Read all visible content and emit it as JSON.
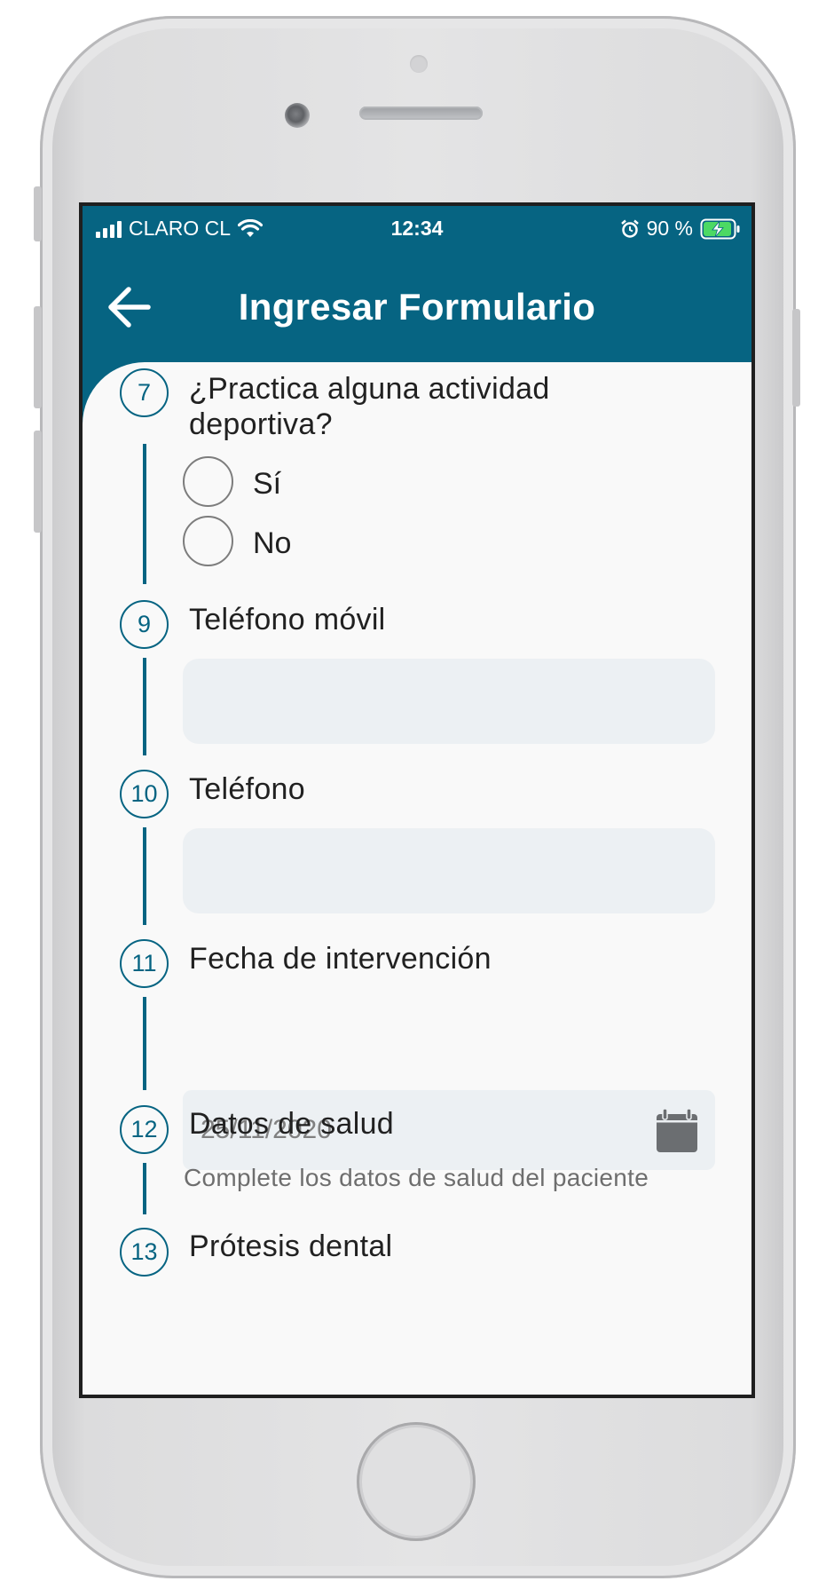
{
  "status_bar": {
    "carrier": "CLARO CL",
    "time": "12:34",
    "battery_percent": "90 %"
  },
  "app_bar": {
    "title": "Ingresar Formulario",
    "back_icon": "arrow-left-icon"
  },
  "colors": {
    "primary": "#066482",
    "background": "#f9f9f9",
    "input_bg": "#ecf0f3",
    "battery_green": "#4cd964"
  },
  "form": {
    "q7": {
      "number": "7",
      "label_line1": "¿Practica alguna actividad",
      "label_line2": "deportiva?",
      "options": [
        "Sí",
        "No"
      ]
    },
    "q9": {
      "number": "9",
      "label": "Teléfono móvil",
      "value": ""
    },
    "q10": {
      "number": "10",
      "label": "Teléfono",
      "value": ""
    },
    "q11": {
      "number": "11",
      "label": "Fecha de intervención",
      "value": "25/11/2020",
      "icon": "calendar-icon"
    },
    "q12": {
      "number": "12",
      "label": "Datos de salud",
      "helper": "Complete los datos de salud del paciente"
    },
    "q13": {
      "number": "13",
      "label": "Prótesis dental"
    }
  }
}
